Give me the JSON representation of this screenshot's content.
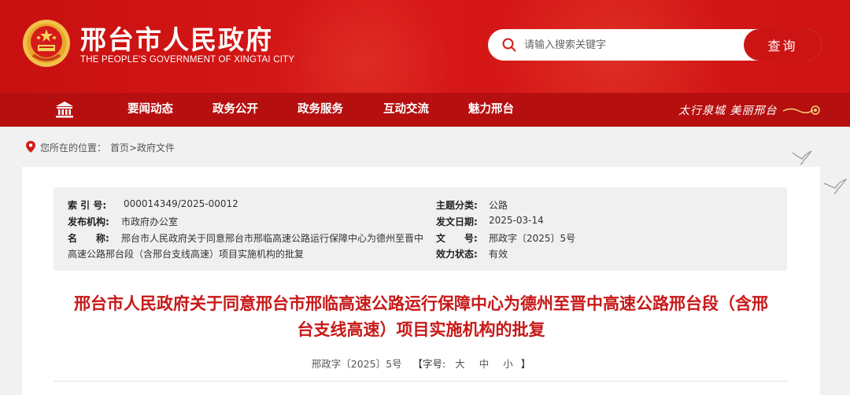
{
  "header": {
    "title": "邢台市人民政府",
    "subtitle": "THE PEOPLE'S GOVERNMENT OF XINGTAI CITY",
    "search_placeholder": "请输入搜索关键字",
    "search_button": "查询",
    "colors": {
      "primary": "#c81010",
      "nav": "#b60f0f",
      "title_red": "#c71818"
    }
  },
  "nav": {
    "home_icon": "home-icon",
    "items": [
      "要闻动态",
      "政务公开",
      "政务服务",
      "互动交流",
      "魅力邢台"
    ],
    "slogan": "太行泉城 美丽邢台"
  },
  "breadcrumb": {
    "label": "您所在的位置：",
    "path": "首页>政府文件"
  },
  "meta": {
    "index_label": "索 引 号:",
    "index_value": "000014349/2025-00012",
    "subject_label": "主题分类:",
    "subject_value": "公路",
    "issuer_label": "发布机构:",
    "issuer_value": "市政府办公室",
    "date_label": "发文日期:",
    "date_value": "2025-03-14",
    "name_label": "名　　称:",
    "name_line1": "邢台市人民政府关于同意邢台市邢临高速公路运行保障中心为德州至晋中",
    "name_line2": "高速公路邢台段（含邢台支线高速）项目实施机构的批复",
    "docno_label": "文　　号:",
    "docno_value": "邢政字〔2025〕5号",
    "status_label": "效力状态:",
    "status_value": "有效"
  },
  "document": {
    "title_line1": "邢台市人民政府关于同意邢台市邢临高速公路运行保障中心为德州至晋中高速公路邢台段（含邢",
    "title_line2": "台支线高速）项目实施机构的批复",
    "doc_number": "邢政字〔2025〕5号",
    "font_size_label": "【字号:",
    "size_large": "大",
    "size_medium": "中",
    "size_small": "小",
    "font_size_close": "】"
  }
}
